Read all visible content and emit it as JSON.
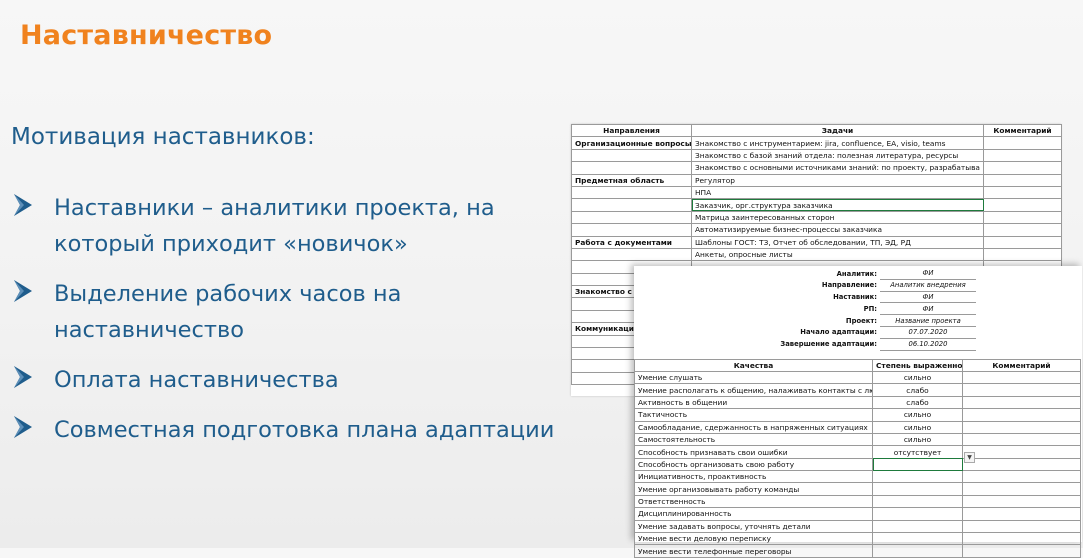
{
  "title": "Наставничество",
  "subtitle": "Мотивация наставников:",
  "bullets": [
    {
      "line1": "Наставники – аналитики проекта, на",
      "line2": "который приходит «новичок»"
    },
    {
      "line1": "Выделение рабочих часов на",
      "line2": "наставничество"
    },
    {
      "line1": "Оплата наставничества",
      "line2": ""
    },
    {
      "line1": "Совместная подготовка плана адаптации",
      "line2": ""
    }
  ],
  "accent_colors": {
    "title": "#f0821e",
    "text": "#1f5d8c"
  },
  "sheet1": {
    "headers": [
      "Направления",
      "Задачи",
      "Комментарий"
    ],
    "rows": [
      [
        "Организационные вопросы",
        "Знакомство с инструментарием: jira, confluence, EA, visio, teams",
        ""
      ],
      [
        "",
        "Знакомство с базой знаний отдела: полезная литература, ресурсы",
        ""
      ],
      [
        "",
        "Знакомство с основными источниками знаний: по проекту, разрабатыва",
        ""
      ],
      [
        "Предметная область",
        "Регулятор",
        ""
      ],
      [
        "",
        "НПА",
        ""
      ],
      [
        "",
        "Заказчик, орг.структура заказчика",
        ""
      ],
      [
        "",
        "Матрица заинтересованных сторон",
        ""
      ],
      [
        "",
        "Автоматизируемые бизнес-процессы заказчика",
        ""
      ],
      [
        "Работа с документами",
        "Шаблоны ГОСТ: ТЗ, Отчет об обследовании, ТП, ЭД, РД",
        ""
      ],
      [
        "",
        "Анкеты, опросные листы",
        ""
      ],
      [
        "",
        "",
        ""
      ],
      [
        "",
        "",
        ""
      ],
      [
        "Знакомство с пр",
        "",
        ""
      ],
      [
        "",
        "",
        ""
      ],
      [
        "",
        "",
        ""
      ],
      [
        "Коммуникации",
        "",
        ""
      ],
      [
        "",
        "",
        ""
      ],
      [
        "",
        "",
        ""
      ],
      [
        "",
        "",
        ""
      ],
      [
        "",
        "",
        ""
      ]
    ]
  },
  "sheet2": {
    "info": [
      {
        "key": "Аналитик:",
        "value": "ФИ"
      },
      {
        "key": "Направление:",
        "value": "Аналитик внедрения"
      },
      {
        "key": "Наставник:",
        "value": "ФИ"
      },
      {
        "key": "РП:",
        "value": "ФИ"
      },
      {
        "key": "Проект:",
        "value": "Название проекта"
      },
      {
        "key": "Начало адаптации:",
        "value": "07.07.2020"
      },
      {
        "key": "Завершение адаптации:",
        "value": "06.10.2020"
      }
    ],
    "headers": [
      "Качества",
      "Степень выраженности",
      "Комментарий"
    ],
    "rows": [
      [
        "Умение слушать",
        "сильно",
        ""
      ],
      [
        "Умение располагать к общению, налаживать контакты с людьми",
        "слабо",
        ""
      ],
      [
        "Активность в общении",
        "слабо",
        ""
      ],
      [
        "Тактичность",
        "сильно",
        ""
      ],
      [
        "Самообладание, сдержанность в напряженных ситуациях",
        "сильно",
        ""
      ],
      [
        "Самостоятельность",
        "сильно",
        ""
      ],
      [
        "Способность признавать свои ошибки",
        "отсутствует",
        ""
      ],
      [
        "Способность организовать свою работу",
        "",
        ""
      ],
      [
        "Инициативность, проактивность",
        "",
        ""
      ],
      [
        "Умение организовывать работу команды",
        "",
        ""
      ],
      [
        "Ответственность",
        "",
        ""
      ],
      [
        "Дисциплинированность",
        "",
        ""
      ],
      [
        "Умение задавать вопросы, уточнять детали",
        "",
        ""
      ],
      [
        "Умение вести деловую переписку",
        "",
        ""
      ],
      [
        "Умение вести телефонные переговоры",
        "",
        ""
      ]
    ]
  }
}
